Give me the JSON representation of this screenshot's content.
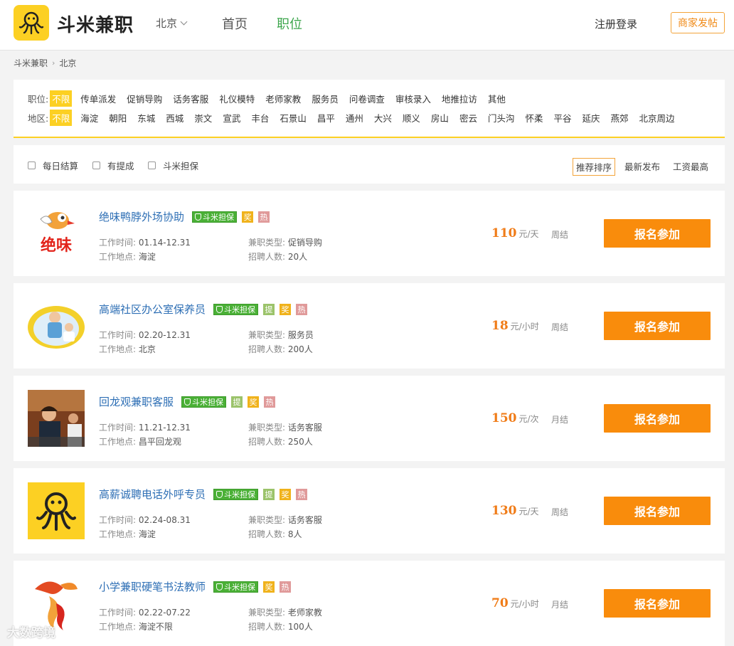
{
  "header": {
    "brand": "斗米兼职",
    "city": "北京",
    "nav_home": "首页",
    "nav_jobs": "职位",
    "login": "注册登录",
    "merchant": "商家发帖"
  },
  "breadcrumb": {
    "home": "斗米兼职",
    "sep": "›",
    "current": "北京"
  },
  "filters": {
    "position_label": "职位:",
    "position_options": [
      "不限",
      "传单派发",
      "促销导购",
      "话务客服",
      "礼仪模特",
      "老师家教",
      "服务员",
      "问卷调查",
      "审核录入",
      "地推拉访",
      "其他"
    ],
    "region_label": "地区:",
    "region_options": [
      "不限",
      "海淀",
      "朝阳",
      "东城",
      "西城",
      "崇文",
      "宣武",
      "丰台",
      "石景山",
      "昌平",
      "通州",
      "大兴",
      "顺义",
      "房山",
      "密云",
      "门头沟",
      "怀柔",
      "平谷",
      "延庆",
      "燕郊",
      "北京周边"
    ]
  },
  "sortbar": {
    "checks": [
      "每日结算",
      "有提成",
      "斗米担保"
    ],
    "sorts": [
      "推荐排序",
      "最新发布",
      "工资最高"
    ]
  },
  "labels": {
    "time": "工作时间:",
    "place": "工作地点:",
    "type": "兼职类型:",
    "count": "招聘人数:",
    "guarantee": "斗米担保",
    "tag_ti": "提",
    "tag_jiang": "奖",
    "tag_re": "热",
    "apply": "报名参加"
  },
  "jobs": [
    {
      "title": "绝味鸭脖外场协助",
      "tags": [
        "guar",
        "jiang",
        "re"
      ],
      "time": "01.14-12.31",
      "place": "海淀",
      "type": "促销导购",
      "count": "20人",
      "price": "110",
      "unit": "元/天",
      "settle": "周结",
      "logo_text": "绝味"
    },
    {
      "title": "高端社区办公室保养员",
      "tags": [
        "guar",
        "ti",
        "jiang",
        "re"
      ],
      "time": "02.20-12.31",
      "place": "北京",
      "type": "服务员",
      "count": "200人",
      "price": "18",
      "unit": "元/小时",
      "settle": "周结"
    },
    {
      "title": "回龙观兼职客服",
      "tags": [
        "guar",
        "ti",
        "jiang",
        "re"
      ],
      "time": "11.21-12.31",
      "place": "昌平回龙观",
      "type": "话务客服",
      "count": "250人",
      "price": "150",
      "unit": "元/次",
      "settle": "月结"
    },
    {
      "title": "高薪诚聘电话外呼专员",
      "tags": [
        "guar",
        "ti",
        "jiang",
        "re"
      ],
      "time": "02.24-08.31",
      "place": "海淀",
      "type": "话务客服",
      "count": "8人",
      "price": "130",
      "unit": "元/天",
      "settle": "周结"
    },
    {
      "title": "小学兼职硬笔书法教师",
      "tags": [
        "guar",
        "jiang",
        "re"
      ],
      "time": "02.22-07.22",
      "place": "海淀不限",
      "type": "老师家教",
      "count": "100人",
      "price": "70",
      "unit": "元/小时",
      "settle": "月结"
    }
  ],
  "watermark": "大数跨境",
  "colors": {
    "accent": "#fcd023",
    "orange": "#f98c0c",
    "green": "#3ba54b",
    "link": "#2e6fb5"
  }
}
